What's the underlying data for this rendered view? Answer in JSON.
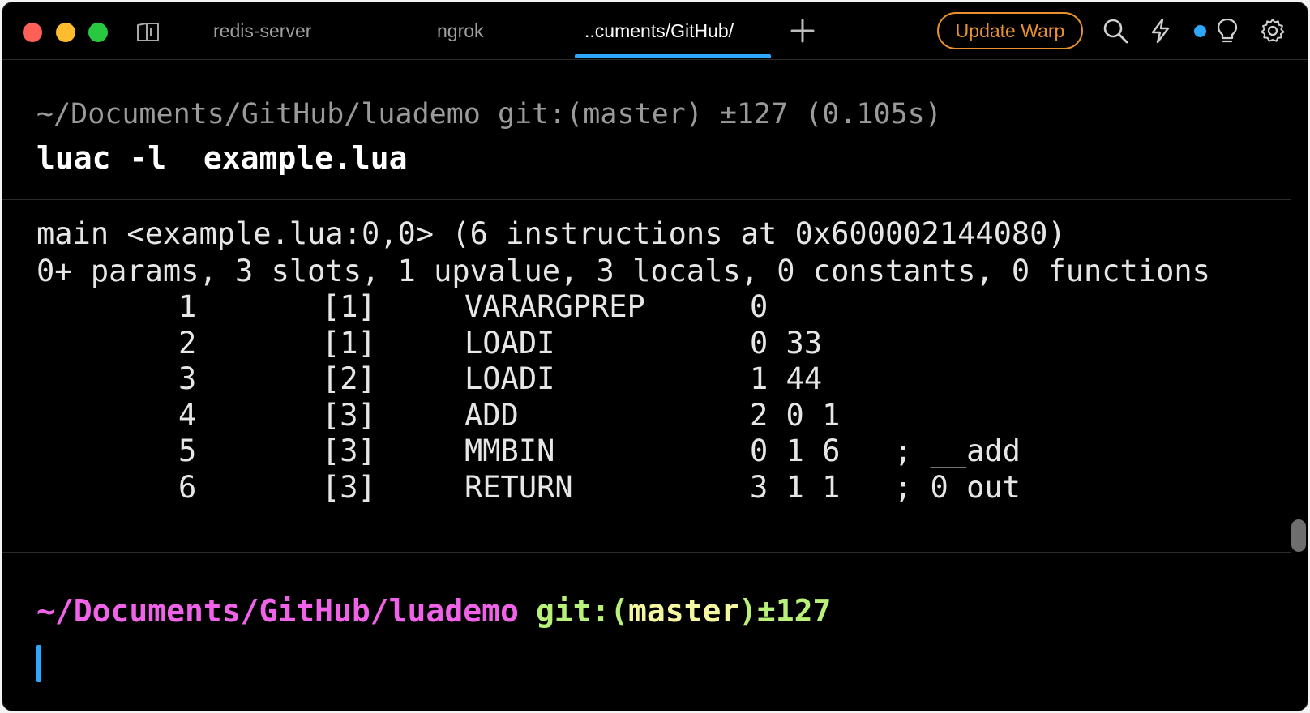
{
  "tabs": [
    {
      "label": "redis-server"
    },
    {
      "label": "ngrok"
    },
    {
      "label": "..cuments/GitHub/"
    }
  ],
  "update_button": "Update Warp",
  "accent_color": "#2ea8ff",
  "block1": {
    "prompt": "~/Documents/GitHub/luademo git:(master) ±127 (0.105s)",
    "command": "luac -l  example.lua"
  },
  "block2": {
    "header1": "main <example.lua:0,0> (6 instructions at 0x600002144080)",
    "header2": "0+ params, 3 slots, 1 upvalue, 3 locals, 0 constants, 0 functions",
    "rows": [
      {
        "num": "1",
        "line": "[1]",
        "op": "VARARGPREP",
        "args": "0",
        "comment": ""
      },
      {
        "num": "2",
        "line": "[1]",
        "op": "LOADI",
        "args": "0 33",
        "comment": ""
      },
      {
        "num": "3",
        "line": "[2]",
        "op": "LOADI",
        "args": "1 44",
        "comment": ""
      },
      {
        "num": "4",
        "line": "[3]",
        "op": "ADD",
        "args": "2 0 1",
        "comment": ""
      },
      {
        "num": "5",
        "line": "[3]",
        "op": "MMBIN",
        "args": "0 1 6",
        "comment": "; __add"
      },
      {
        "num": "6",
        "line": "[3]",
        "op": "RETURN",
        "args": "3 1 1",
        "comment": "; 0 out"
      }
    ]
  },
  "prompt": {
    "path": "~/Documents/GitHub/luademo",
    "git_prefix": "git:(",
    "branch": "master",
    "suffix": ")±127"
  }
}
